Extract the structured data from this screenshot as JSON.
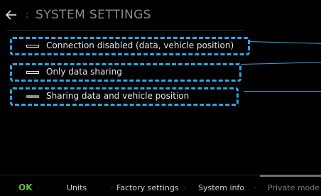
{
  "header": {
    "back_icon": "arrow-left-icon",
    "separator": ":",
    "title": "SYSTEM SETTINGS"
  },
  "options": [
    {
      "label": "Connection disabled (data, vehicle position)",
      "swatch": "outline-white"
    },
    {
      "label": "Only data sharing",
      "swatch": "outline-white"
    },
    {
      "label": "Sharing data and vehicle position",
      "swatch": "filled-gray"
    }
  ],
  "bottom_bar": {
    "ok": "OK",
    "separator": ":",
    "dot": "·",
    "units": "Units",
    "factory_settings": "Factory settings",
    "system_info": "System info",
    "private_mode": "Private mode"
  },
  "colors": {
    "background": "#000000",
    "annotation_blue": "#29a8e8",
    "ok_green": "#5fbf3a",
    "text": "#e6e6e6",
    "title": "#8a8a8a"
  }
}
